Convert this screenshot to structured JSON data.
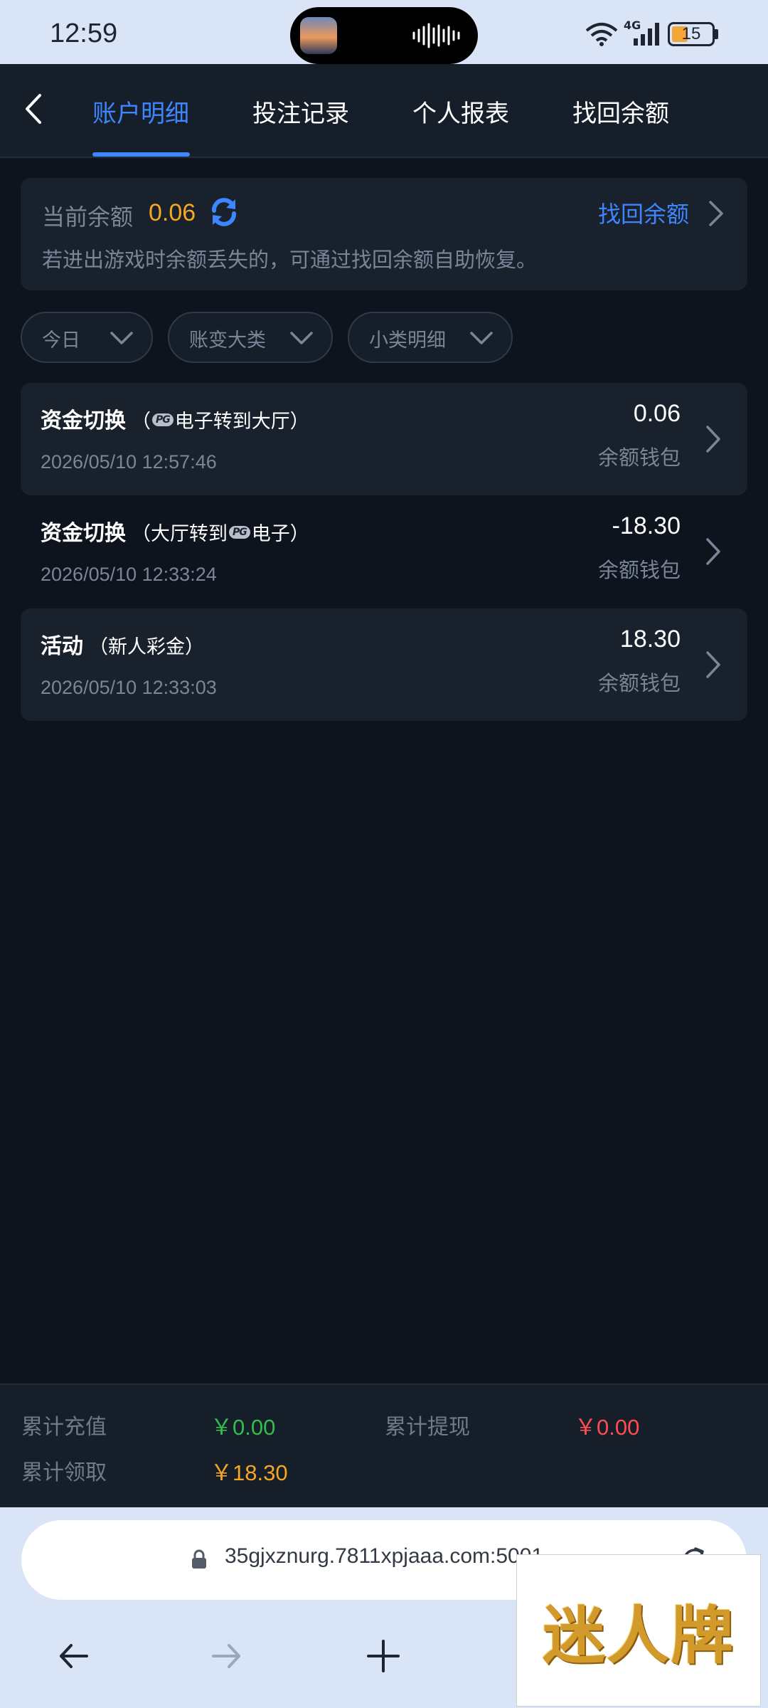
{
  "status_bar": {
    "time": "12:59",
    "network": "4G",
    "battery": "15"
  },
  "nav": {
    "tabs": [
      {
        "label": "账户明细",
        "active": true
      },
      {
        "label": "投注记录",
        "active": false
      },
      {
        "label": "个人报表",
        "active": false
      },
      {
        "label": "找回余额",
        "active": false
      }
    ]
  },
  "balance": {
    "label": "当前余额",
    "value": "0.06",
    "recover_link": "找回余额",
    "note": "若进出游戏时余额丢失的，可通过找回余额自助恢复。"
  },
  "filters": [
    {
      "label": "今日"
    },
    {
      "label": "账变大类"
    },
    {
      "label": "小类明细"
    }
  ],
  "records": [
    {
      "type": "资金切换",
      "detail_pre": "（",
      "detail_mid": "电子转到大厅）",
      "detail_post": "",
      "pg_logo_position": "after_open",
      "time": "2026/05/10 12:57:46",
      "amount": "0.06",
      "wallet": "余额钱包"
    },
    {
      "type": "资金切换",
      "detail_pre": "（大厅转到",
      "detail_mid": "电子）",
      "detail_post": "",
      "pg_logo_position": "inline",
      "time": "2026/05/10 12:33:24",
      "amount": "-18.30",
      "wallet": "余额钱包"
    },
    {
      "type": "活动",
      "detail_pre": "（新人彩金）",
      "detail_mid": "",
      "detail_post": "",
      "pg_logo_position": "none",
      "time": "2026/05/10 12:33:03",
      "amount": "18.30",
      "wallet": "余额钱包"
    }
  ],
  "summary": {
    "total_deposit_label": "累计充值",
    "total_deposit_value": "￥0.00",
    "total_withdraw_label": "累计提现",
    "total_withdraw_value": "￥0.00",
    "total_claim_label": "累计领取",
    "total_claim_value": "￥18.30"
  },
  "browser": {
    "url": "35gjxznurg.7811xpjaaa.com:5001"
  },
  "watermark": {
    "text": "迷人牌"
  },
  "colors": {
    "accent": "#3e86ff",
    "balance": "#f5a623",
    "deposit": "#2fbf4a",
    "withdraw": "#ff4d4f",
    "claim": "#f5a623"
  }
}
